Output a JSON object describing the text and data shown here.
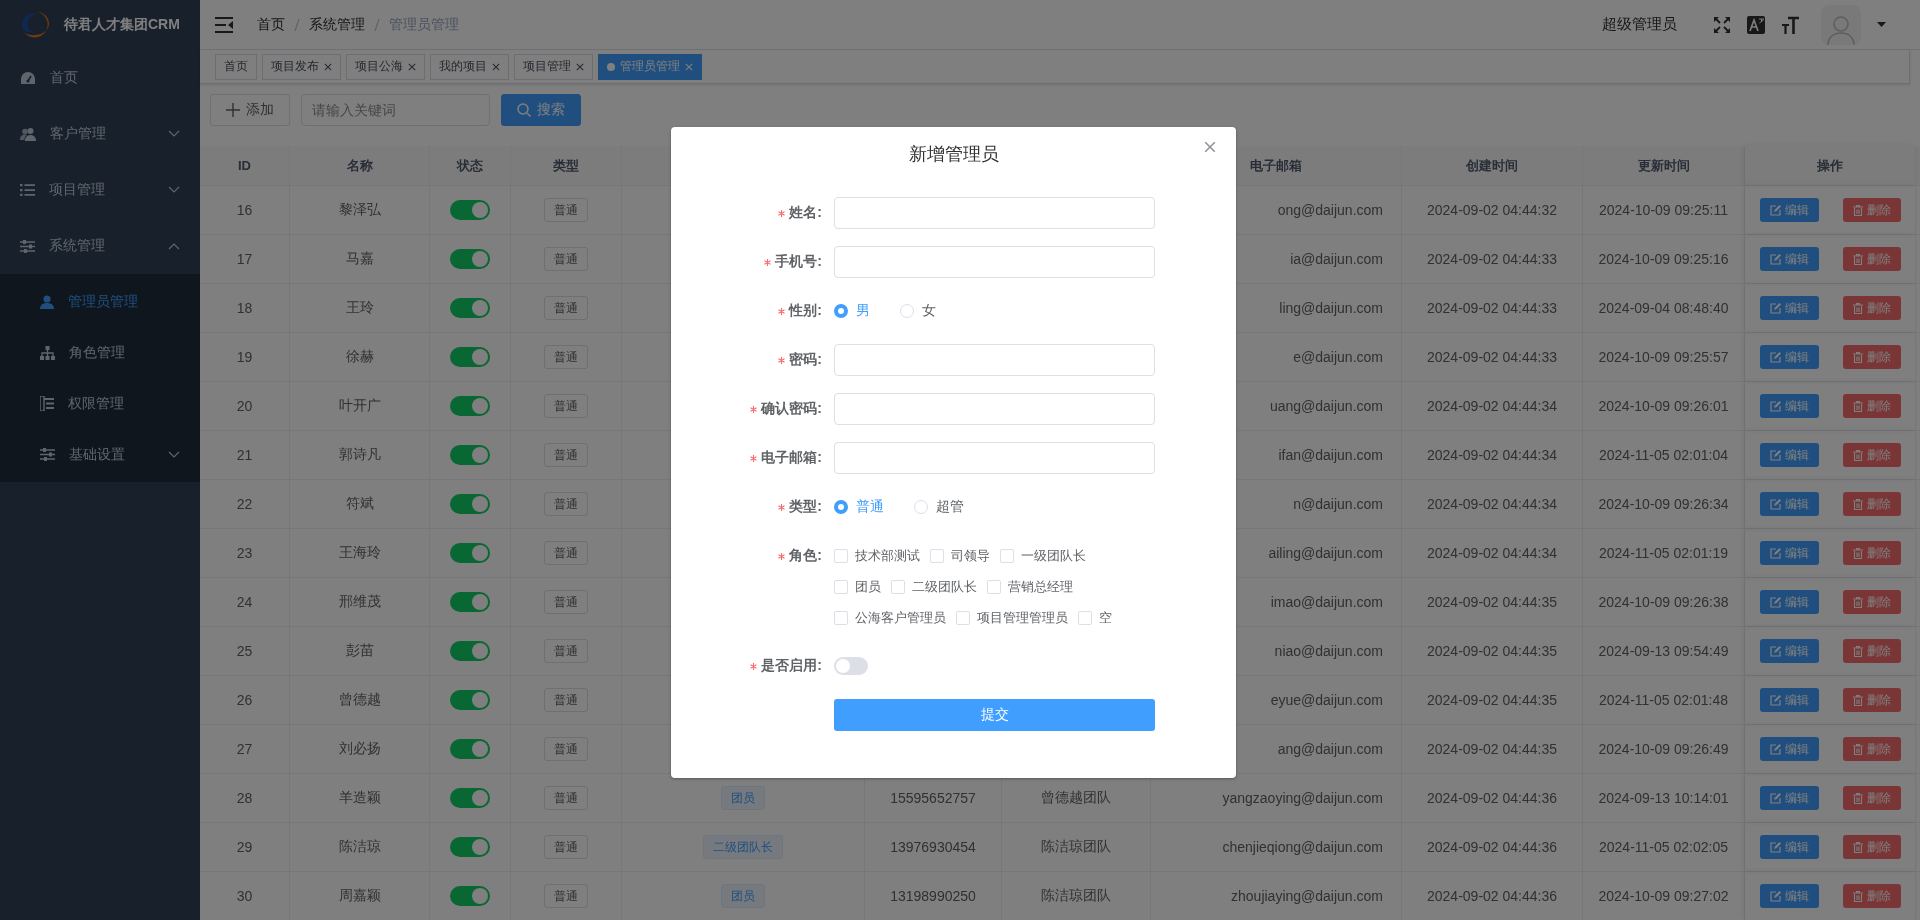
{
  "sidebar": {
    "title": "待君人才集团CRM",
    "items": [
      {
        "kind": "link",
        "label": "首页",
        "selected": false
      },
      {
        "kind": "submenu",
        "label": "客户管理",
        "selected": false,
        "expanded": false
      },
      {
        "kind": "submenu",
        "label": "项目管理",
        "selected": false,
        "expanded": false
      },
      {
        "kind": "submenu",
        "label": "系统管理",
        "selected": false,
        "expanded": true,
        "children": [
          {
            "kind": "link",
            "label": "管理员管理",
            "selected": true
          },
          {
            "kind": "link",
            "label": "角色管理",
            "selected": false
          },
          {
            "kind": "link",
            "label": "权限管理",
            "selected": false
          },
          {
            "kind": "submenu",
            "label": "基础设置",
            "selected": false,
            "expanded": false
          }
        ]
      }
    ]
  },
  "navbar": {
    "breadcrumb": [
      "首页",
      "系统管理",
      "管理员管理"
    ],
    "username": "超级管理员"
  },
  "tags": [
    {
      "label": "首页",
      "closable": false,
      "selected": false
    },
    {
      "label": "项目发布",
      "closable": true,
      "selected": false
    },
    {
      "label": "项目公海",
      "closable": true,
      "selected": false
    },
    {
      "label": "我的项目",
      "closable": true,
      "selected": false
    },
    {
      "label": "项目管理",
      "closable": true,
      "selected": false
    },
    {
      "label": "管理员管理",
      "closable": true,
      "selected": true
    }
  ],
  "toolbar": {
    "add_button": "添加",
    "search": {
      "placeholder": "请输入关键词"
    },
    "search_button": "搜索"
  },
  "table": {
    "columns": [
      "ID",
      "名称",
      "状态",
      "类型",
      null,
      null,
      null,
      "电子邮箱",
      "创建时间",
      "更新时间",
      "操作"
    ],
    "rows": [
      {
        "id": "16",
        "name": "黎泽弘",
        "enabled": true,
        "type": "普通",
        "email": "ong@daijun.com",
        "created": "2024-09-02 04:44:32",
        "updated": "2024-10-09 09:25:11",
        "actions": [
          {
            "kind": "edit",
            "label": "编辑"
          },
          {
            "kind": "delete",
            "label": "删除"
          }
        ]
      },
      {
        "id": "17",
        "name": "马嘉",
        "enabled": true,
        "type": "普通",
        "email": "ia@daijun.com",
        "created": "2024-09-02 04:44:33",
        "updated": "2024-10-09 09:25:16",
        "actions": [
          {
            "kind": "edit",
            "label": "编辑"
          },
          {
            "kind": "delete",
            "label": "删除"
          }
        ]
      },
      {
        "id": "18",
        "name": "王玲",
        "enabled": true,
        "type": "普通",
        "email": "ling@daijun.com",
        "created": "2024-09-02 04:44:33",
        "updated": "2024-09-04 08:48:40",
        "actions": [
          {
            "kind": "edit",
            "label": "编辑"
          },
          {
            "kind": "delete",
            "label": "删除"
          }
        ]
      },
      {
        "id": "19",
        "name": "徐赫",
        "enabled": true,
        "type": "普通",
        "email": "e@daijun.com",
        "created": "2024-09-02 04:44:33",
        "updated": "2024-10-09 09:25:57",
        "actions": [
          {
            "kind": "edit",
            "label": "编辑"
          },
          {
            "kind": "delete",
            "label": "删除"
          }
        ]
      },
      {
        "id": "20",
        "name": "叶开广",
        "enabled": true,
        "type": "普通",
        "email": "uang@daijun.com",
        "created": "2024-09-02 04:44:34",
        "updated": "2024-10-09 09:26:01",
        "actions": [
          {
            "kind": "edit",
            "label": "编辑"
          },
          {
            "kind": "delete",
            "label": "删除"
          }
        ]
      },
      {
        "id": "21",
        "name": "郭诗凡",
        "enabled": true,
        "type": "普通",
        "email": "ifan@daijun.com",
        "created": "2024-09-02 04:44:34",
        "updated": "2024-11-05 02:01:04",
        "actions": [
          {
            "kind": "edit",
            "label": "编辑"
          },
          {
            "kind": "delete",
            "label": "删除"
          }
        ]
      },
      {
        "id": "22",
        "name": "符斌",
        "enabled": true,
        "type": "普通",
        "email": "n@daijun.com",
        "created": "2024-09-02 04:44:34",
        "updated": "2024-10-09 09:26:34",
        "actions": [
          {
            "kind": "edit",
            "label": "编辑"
          },
          {
            "kind": "delete",
            "label": "删除"
          }
        ]
      },
      {
        "id": "23",
        "name": "王海玲",
        "enabled": true,
        "type": "普通",
        "email": "ailing@daijun.com",
        "created": "2024-09-02 04:44:34",
        "updated": "2024-11-05 02:01:19",
        "actions": [
          {
            "kind": "edit",
            "label": "编辑"
          },
          {
            "kind": "delete",
            "label": "删除"
          }
        ]
      },
      {
        "id": "24",
        "name": "邢维茂",
        "enabled": true,
        "type": "普通",
        "email": "imao@daijun.com",
        "created": "2024-09-02 04:44:35",
        "updated": "2024-10-09 09:26:38",
        "actions": [
          {
            "kind": "edit",
            "label": "编辑"
          },
          {
            "kind": "delete",
            "label": "删除"
          }
        ]
      },
      {
        "id": "25",
        "name": "彭苗",
        "enabled": true,
        "type": "普通",
        "email": "niao@daijun.com",
        "created": "2024-09-02 04:44:35",
        "updated": "2024-09-13 09:54:49",
        "actions": [
          {
            "kind": "edit",
            "label": "编辑"
          },
          {
            "kind": "delete",
            "label": "删除"
          }
        ]
      },
      {
        "id": "26",
        "name": "曾德越",
        "enabled": true,
        "type": "普通",
        "email": "eyue@daijun.com",
        "created": "2024-09-02 04:44:35",
        "updated": "2024-11-05 02:01:48",
        "actions": [
          {
            "kind": "edit",
            "label": "编辑"
          },
          {
            "kind": "delete",
            "label": "删除"
          }
        ]
      },
      {
        "id": "27",
        "name": "刘必扬",
        "enabled": true,
        "type": "普通",
        "email": "ang@daijun.com",
        "created": "2024-09-02 04:44:35",
        "updated": "2024-10-09 09:26:49",
        "actions": [
          {
            "kind": "edit",
            "label": "编辑"
          },
          {
            "kind": "delete",
            "label": "删除"
          }
        ]
      },
      {
        "id": "28",
        "name": "羊造颖",
        "enabled": true,
        "type": "普通",
        "role": "团员",
        "phone": "15595652757",
        "team": "曾德越团队",
        "email": "yangzaoying@daijun.com",
        "created": "2024-09-02 04:44:36",
        "updated": "2024-09-13 10:14:01",
        "actions": [
          {
            "kind": "edit",
            "label": "编辑"
          },
          {
            "kind": "delete",
            "label": "删除"
          }
        ]
      },
      {
        "id": "29",
        "name": "陈洁琼",
        "enabled": true,
        "type": "普通",
        "role": "二级团队长",
        "phone": "13976930454",
        "team": "陈洁琼团队",
        "email": "chenjieqiong@daijun.com",
        "created": "2024-09-02 04:44:36",
        "updated": "2024-11-05 02:02:05",
        "actions": [
          {
            "kind": "edit",
            "label": "编辑"
          },
          {
            "kind": "delete",
            "label": "删除"
          }
        ]
      },
      {
        "id": "30",
        "name": "周嘉颖",
        "enabled": true,
        "type": "普通",
        "role": "团员",
        "phone": "13198990250",
        "team": "陈洁琼团队",
        "email": "zhoujiaying@daijun.com",
        "created": "2024-09-02 04:44:36",
        "updated": "2024-10-09 09:27:02",
        "actions": [
          {
            "kind": "edit",
            "label": "编辑"
          },
          {
            "kind": "delete",
            "label": "删除"
          }
        ]
      }
    ]
  },
  "dialog": {
    "title": "新增管理员",
    "fields": [
      {
        "kind": "input",
        "label": "姓名:",
        "required": true
      },
      {
        "kind": "input",
        "label": "手机号:",
        "required": true
      },
      {
        "kind": "radio",
        "label": "性别:",
        "required": true,
        "options": [
          {
            "label": "男",
            "selected": true
          },
          {
            "label": "女",
            "selected": false
          }
        ]
      },
      {
        "kind": "input",
        "label": "密码:",
        "required": true
      },
      {
        "kind": "input",
        "label": "确认密码:",
        "required": true
      },
      {
        "kind": "input",
        "label": "电子邮箱:",
        "required": true
      },
      {
        "kind": "radio",
        "label": "类型:",
        "required": true,
        "options": [
          {
            "label": "普通",
            "selected": true
          },
          {
            "label": "超管",
            "selected": false
          }
        ]
      },
      {
        "kind": "checkbox",
        "label": "角色:",
        "required": true,
        "options": [
          {
            "label": "技术部测试",
            "checked": false
          },
          {
            "label": "司领导",
            "checked": false
          },
          {
            "label": "一级团队长",
            "checked": false
          },
          {
            "label": "团员",
            "checked": false
          },
          {
            "label": "二级团队长",
            "checked": false
          },
          {
            "label": "营销总经理",
            "checked": false
          },
          {
            "label": "公海客户管理员",
            "checked": false
          },
          {
            "label": "项目管理管理员",
            "checked": false
          },
          {
            "label": "空",
            "checked": false
          }
        ]
      },
      {
        "kind": "switch",
        "label": "是否启用:",
        "required": true,
        "on": false
      }
    ],
    "submit": "提交"
  }
}
